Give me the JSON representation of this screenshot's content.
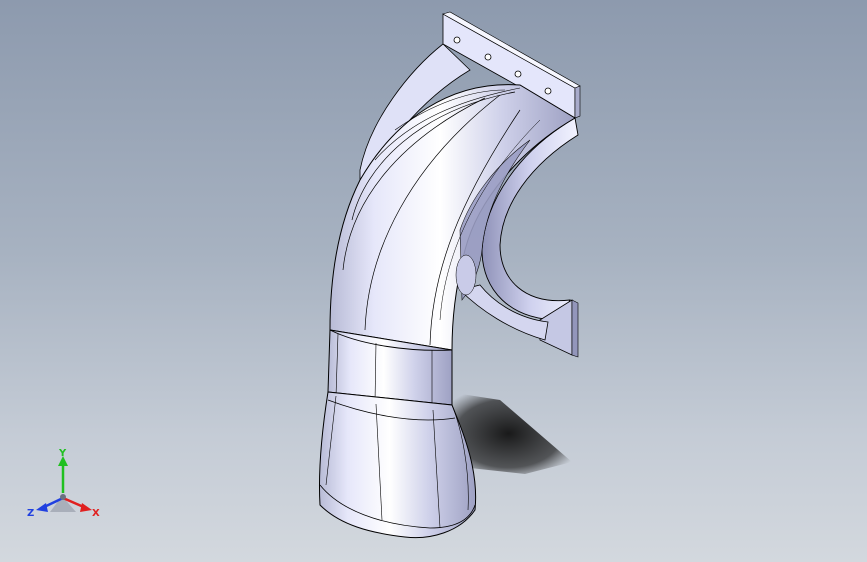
{
  "viewport": {
    "background_top": "#8d9aae",
    "background_bottom": "#d3d8de"
  },
  "model": {
    "part_color": "#d9dbf3",
    "shadow_color": "#111111",
    "edge_color": "#000000",
    "flange_hole_count": 4
  },
  "triad": {
    "x_label": "X",
    "y_label": "Y",
    "z_label": "Z",
    "x_color": "#e02020",
    "y_color": "#20c020",
    "z_color": "#2040e0"
  }
}
